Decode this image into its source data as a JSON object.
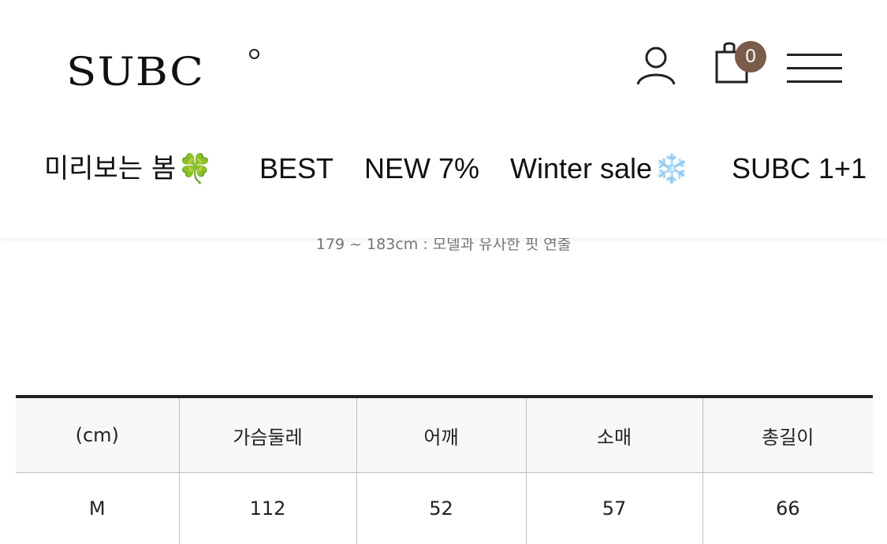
{
  "brand": {
    "logo_text": "SUBC",
    "accent_color": "#7a5c4a"
  },
  "header_icons": {
    "user": "user-icon",
    "cart": "shopping-bag-icon",
    "menu": "hamburger-menu-icon"
  },
  "cart": {
    "count": "0"
  },
  "nav": [
    {
      "label": "미리보는 봄",
      "emoji": "🍀"
    },
    {
      "label": "BEST",
      "emoji": ""
    },
    {
      "label": "NEW 7%",
      "emoji": ""
    },
    {
      "label": "Winter sale",
      "emoji": "❄️"
    },
    {
      "label": "SUBC 1+1",
      "emoji": ""
    }
  ],
  "model_note": "179 ~ 183cm :  모델과 유사한 핏 연출",
  "size_table": {
    "headers": [
      "(cm)",
      "가슴둘레",
      "어깨",
      "소매",
      "총길이"
    ],
    "rows": [
      [
        "M",
        "112",
        "52",
        "57",
        "66"
      ]
    ]
  }
}
